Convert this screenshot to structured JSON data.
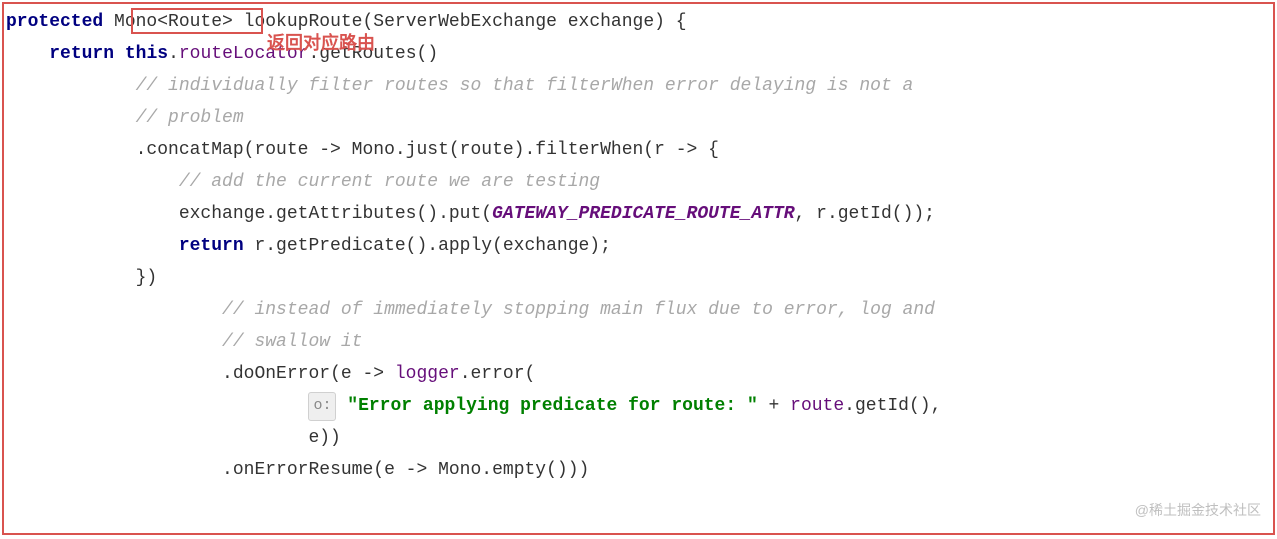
{
  "annotation_label": "返回对应路由",
  "watermark": "@稀土掘金技术社区",
  "hint_label": "o:",
  "code": {
    "l1": {
      "kw_protected": "protected",
      "type": " Mono<Route> ",
      "method": "lookupRoute",
      "params": "(ServerWebExchange exchange) {"
    },
    "l2": {
      "indent": "    ",
      "kw_return": "return",
      "sp": " ",
      "kw_this": "this",
      "dot": ".",
      "member": "routeLocator",
      "rest": ".getRoutes()"
    },
    "l3": {
      "indent": "            ",
      "comment": "// individually filter routes so that filterWhen error delaying is not a"
    },
    "l4": {
      "indent": "            ",
      "comment": "// problem"
    },
    "l5": {
      "indent": "            ",
      "text": ".concatMap(route -> Mono.just(route).filterWhen(r -> {"
    },
    "l6": {
      "indent": "                ",
      "comment": "// add the current route we are testing"
    },
    "l7": {
      "indent": "                ",
      "prefix": "exchange.getAttributes().put(",
      "static": "GATEWAY_PREDICATE_ROUTE_ATTR",
      "suffix": ", r.getId());"
    },
    "l8": {
      "indent": "                ",
      "kw_return": "return",
      "rest": " r.getPredicate().apply(exchange);"
    },
    "l9": {
      "indent": "            ",
      "text": "})"
    },
    "l10": {
      "indent": "                    ",
      "comment": "// instead of immediately stopping main flux due to error, log and"
    },
    "l11": {
      "indent": "                    ",
      "comment": "// swallow it"
    },
    "l12": {
      "indent": "                    ",
      "prefix": ".doOnError(e -> ",
      "logger": "logger",
      "suffix": ".error("
    },
    "l13": {
      "indent": "                            ",
      "string": "\"Error applying predicate for route: \"",
      "plus": " + ",
      "route": "route",
      "suffix": ".getId(),"
    },
    "l14": {
      "indent": "                            ",
      "text": "e))"
    },
    "l15": {
      "indent": "                    ",
      "text": ".onErrorResume(e -> Mono.empty()))"
    }
  }
}
